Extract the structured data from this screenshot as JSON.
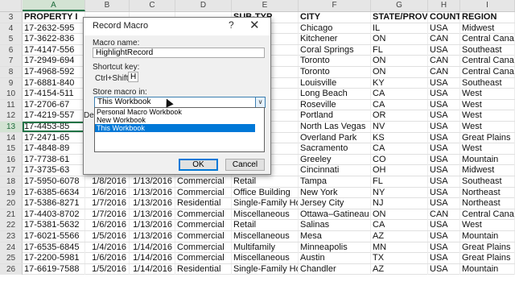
{
  "columns": [
    {
      "letter": "A",
      "selected": true
    },
    {
      "letter": "B",
      "selected": false
    },
    {
      "letter": "C",
      "selected": false
    },
    {
      "letter": "D",
      "selected": false
    },
    {
      "letter": "E",
      "selected": false
    },
    {
      "letter": "F",
      "selected": false
    },
    {
      "letter": "G",
      "selected": false
    },
    {
      "letter": "H",
      "selected": false
    },
    {
      "letter": "I",
      "selected": false
    }
  ],
  "header_row": {
    "num": "3",
    "cells": [
      "PROPERTY I",
      "",
      "",
      "",
      "SUB-TYP",
      "CITY",
      "STATE/PROVINC",
      "COUNTRY",
      "REGION"
    ]
  },
  "rows": [
    {
      "num": "4",
      "cells": [
        "17-2632-595",
        "",
        "",
        "",
        "",
        "Chicago",
        "IL",
        "USA",
        "Midwest"
      ]
    },
    {
      "num": "5",
      "cells": [
        "17-3622-836",
        "",
        "",
        "",
        "",
        "Kitchener",
        "ON",
        "CAN",
        "Central Canada"
      ]
    },
    {
      "num": "6",
      "cells": [
        "17-4147-556",
        "",
        "",
        "",
        "e",
        "Coral Springs",
        "FL",
        "USA",
        "Southeast"
      ]
    },
    {
      "num": "7",
      "cells": [
        "17-2949-694",
        "",
        "",
        "",
        "",
        "Toronto",
        "ON",
        "CAN",
        "Central Canada"
      ]
    },
    {
      "num": "8",
      "cells": [
        "17-4968-592",
        "",
        "",
        "",
        "",
        "Toronto",
        "ON",
        "CAN",
        "Central Canada"
      ]
    },
    {
      "num": "9",
      "cells": [
        "17-6881-840",
        "",
        "",
        "",
        "",
        "Louisville",
        "KY",
        "USA",
        "Southeast"
      ]
    },
    {
      "num": "10",
      "cells": [
        "17-4154-511",
        "",
        "",
        "",
        "",
        "Long Beach",
        "CA",
        "USA",
        "West"
      ]
    },
    {
      "num": "11",
      "cells": [
        "17-2706-67",
        "",
        "",
        "",
        "",
        "Roseville",
        "CA",
        "USA",
        "West"
      ]
    },
    {
      "num": "12",
      "cells": [
        "17-4219-557",
        "",
        "",
        "",
        "lding",
        "Portland",
        "OR",
        "USA",
        "West"
      ]
    },
    {
      "num": "13",
      "cells": [
        "17-4453-85",
        "",
        "",
        "",
        "",
        "North Las Vegas",
        "NV",
        "USA",
        "West"
      ]
    },
    {
      "num": "14",
      "cells": [
        "17-2471-65",
        "",
        "",
        "",
        "",
        "Overland Park",
        "KS",
        "USA",
        "Great Plains"
      ]
    },
    {
      "num": "15",
      "cells": [
        "17-4848-89",
        "",
        "",
        "",
        "",
        "Sacramento",
        "CA",
        "USA",
        "West"
      ]
    },
    {
      "num": "16",
      "cells": [
        "17-7738-61",
        "",
        "",
        "",
        "ly Hom",
        "Greeley",
        "CO",
        "USA",
        "Mountain"
      ]
    },
    {
      "num": "17",
      "cells": [
        "17-3735-63",
        "",
        "",
        "",
        "",
        "Cincinnati",
        "OH",
        "USA",
        "Midwest"
      ]
    },
    {
      "num": "18",
      "cells": [
        "17-5950-6078",
        "1/8/2016",
        "1/13/2016",
        "Commercial",
        "Retail",
        "Tampa",
        "FL",
        "USA",
        "Southeast"
      ]
    },
    {
      "num": "19",
      "cells": [
        "17-6385-6634",
        "1/6/2016",
        "1/13/2016",
        "Commercial",
        "Office Building",
        "New York",
        "NY",
        "USA",
        "Northeast"
      ]
    },
    {
      "num": "20",
      "cells": [
        "17-5386-8271",
        "1/7/2016",
        "1/13/2016",
        "Residential",
        "Single-Family Home",
        "Jersey City",
        "NJ",
        "USA",
        "Northeast"
      ]
    },
    {
      "num": "21",
      "cells": [
        "17-4403-8702",
        "1/7/2016",
        "1/13/2016",
        "Commercial",
        "Miscellaneous",
        "Ottawa–Gatineau",
        "ON",
        "CAN",
        "Central Canada"
      ]
    },
    {
      "num": "22",
      "cells": [
        "17-5381-5632",
        "1/6/2016",
        "1/13/2016",
        "Commercial",
        "Retail",
        "Salinas",
        "CA",
        "USA",
        "West"
      ]
    },
    {
      "num": "23",
      "cells": [
        "17-6021-5566",
        "1/5/2016",
        "1/13/2016",
        "Commercial",
        "Miscellaneous",
        "Mesa",
        "AZ",
        "USA",
        "Mountain"
      ]
    },
    {
      "num": "24",
      "cells": [
        "17-6535-6845",
        "1/4/2016",
        "1/14/2016",
        "Commercial",
        "Multifamily",
        "Minneapolis",
        "MN",
        "USA",
        "Great Plains"
      ]
    },
    {
      "num": "25",
      "cells": [
        "17-2200-5981",
        "1/6/2016",
        "1/14/2016",
        "Commercial",
        "Miscellaneous",
        "Austin",
        "TX",
        "USA",
        "Great Plains"
      ]
    },
    {
      "num": "26",
      "cells": [
        "17-6619-7588",
        "1/5/2016",
        "1/14/2016",
        "Residential",
        "Single-Family Home",
        "Chandler",
        "AZ",
        "USA",
        "Mountain"
      ]
    }
  ],
  "dialog": {
    "title": "Record Macro",
    "help": "?",
    "close": "✕",
    "macro_name_label": "Macro name:",
    "macro_name_value": "HighlightRecord",
    "shortcut_label": "Shortcut key:",
    "shortcut_prefix": "Ctrl+Shift+",
    "shortcut_value": "H",
    "store_label": "Store macro in:",
    "store_value": "This Workbook",
    "description_label": "Des",
    "options": [
      "Personal Macro Workbook",
      "New Workbook",
      "This Workbook"
    ],
    "highlighted_option": 2,
    "ok": "OK",
    "cancel": "Cancel"
  },
  "colors": {
    "accent": "#217346",
    "highlight": "#0078d7"
  }
}
